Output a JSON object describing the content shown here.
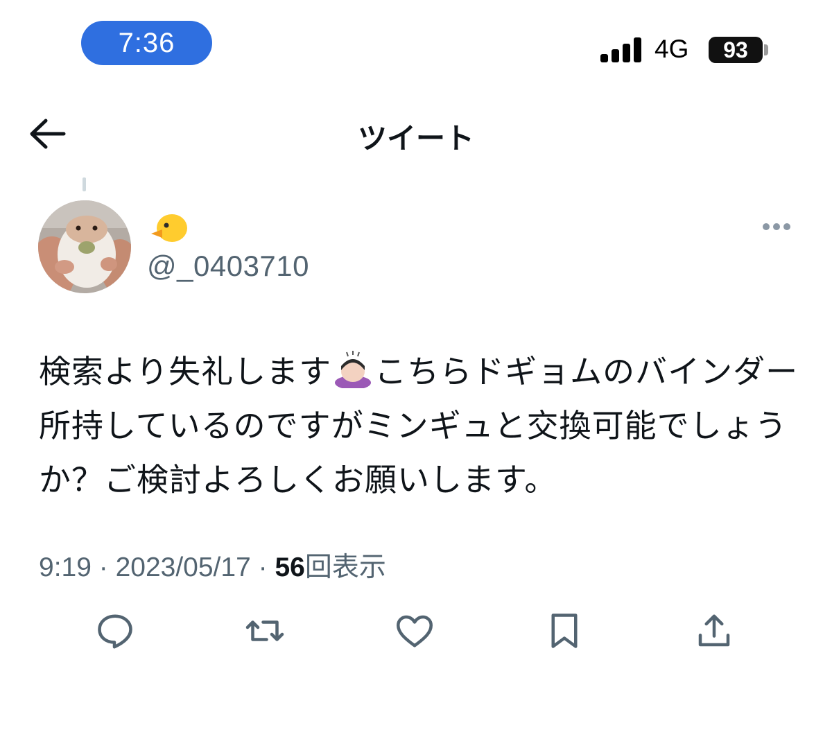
{
  "status_bar": {
    "time": "7:36",
    "network": "4G",
    "battery": "93"
  },
  "header": {
    "title": "ツイート",
    "back_icon": "arrow-left-icon"
  },
  "tweet": {
    "display_name_icon": "chick-emoji",
    "handle": "@_0403710",
    "text_before_emoji": "検索より失礼します",
    "text_emoji": "person-bowing-emoji",
    "text_after_emoji": "こちらドギョムのバインダー所持しているのですがミンギュと交換可能でしょうか？ご検討よろしくお願いします。",
    "time": "9:19",
    "separator": " · ",
    "date": "2023/05/17",
    "view_count": "56",
    "views_label": "回表示"
  },
  "actions": [
    {
      "icon": "reply-icon"
    },
    {
      "icon": "retweet-icon"
    },
    {
      "icon": "like-icon"
    },
    {
      "icon": "bookmark-icon"
    },
    {
      "icon": "share-icon"
    }
  ],
  "colors": {
    "time_pill": "#2f6fe0",
    "secondary_text": "#536471",
    "primary_text": "#0f1419"
  }
}
